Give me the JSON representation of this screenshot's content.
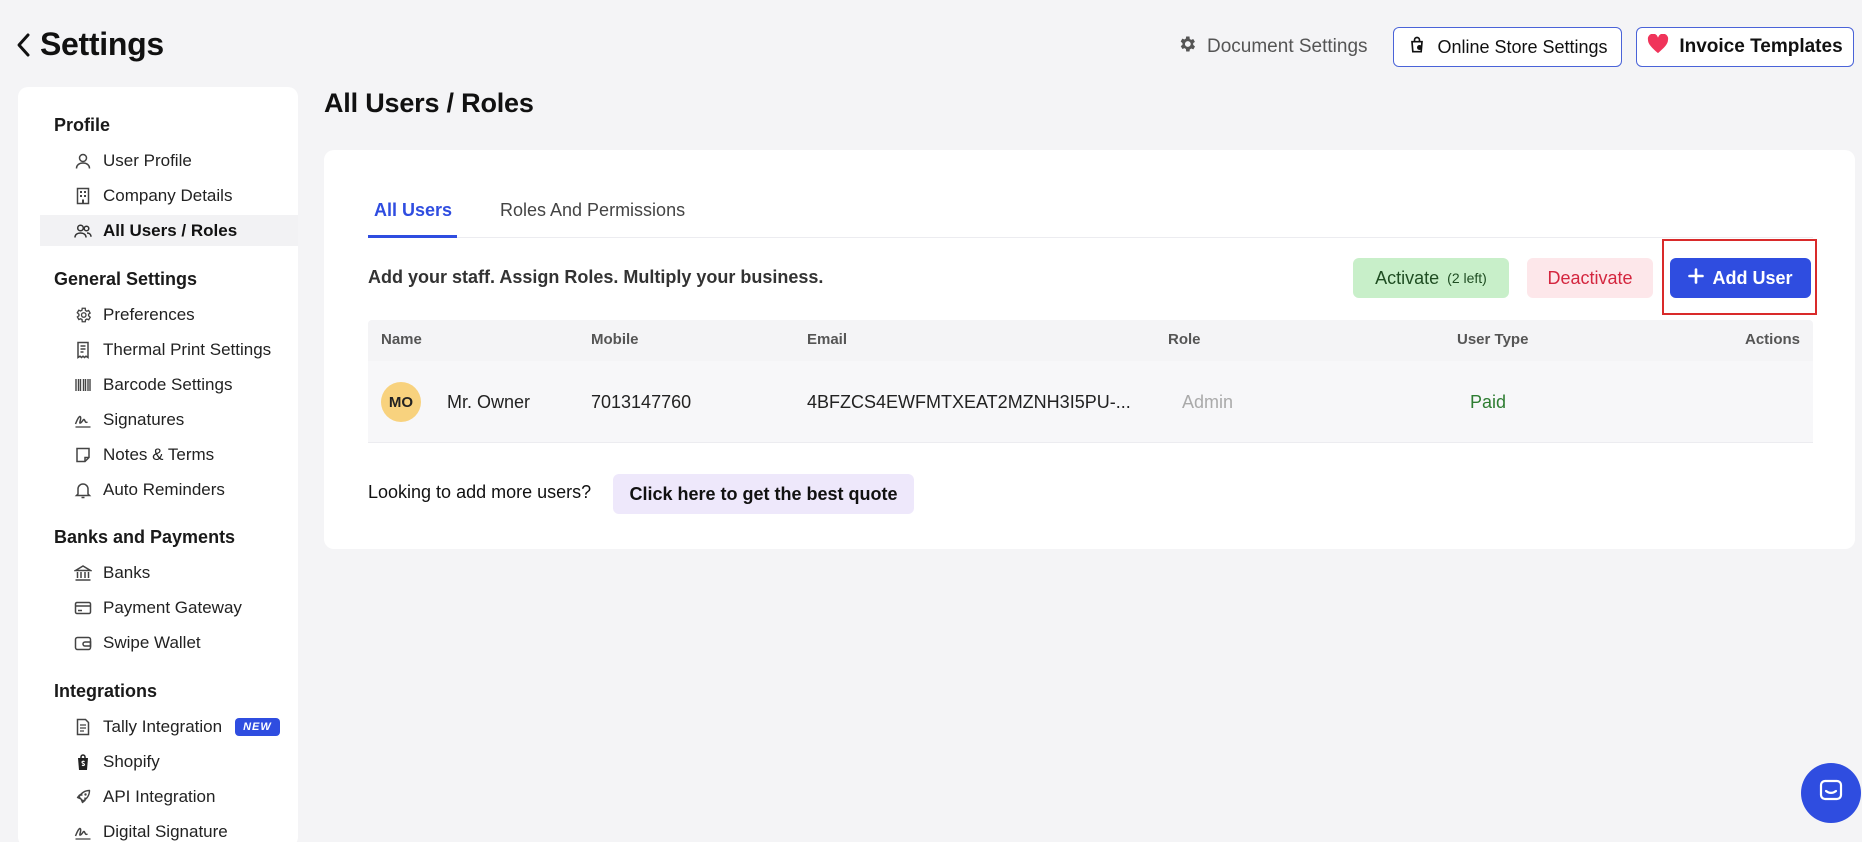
{
  "header": {
    "title": "Settings",
    "document_settings": "Document Settings",
    "online_store_settings": "Online Store Settings",
    "invoice_templates": "Invoice Templates"
  },
  "sidebar": {
    "sections": [
      {
        "title": "Profile",
        "items": [
          {
            "label": "User Profile",
            "icon": "user-icon"
          },
          {
            "label": "Company Details",
            "icon": "building-icon"
          },
          {
            "label": "All Users / Roles",
            "icon": "users-icon",
            "active": true
          }
        ]
      },
      {
        "title": "General Settings",
        "items": [
          {
            "label": "Preferences",
            "icon": "gear-icon"
          },
          {
            "label": "Thermal Print Settings",
            "icon": "receipt-icon"
          },
          {
            "label": "Barcode Settings",
            "icon": "barcode-icon"
          },
          {
            "label": "Signatures",
            "icon": "signature-icon"
          },
          {
            "label": "Notes & Terms",
            "icon": "note-icon"
          },
          {
            "label": "Auto Reminders",
            "icon": "bell-icon"
          }
        ]
      },
      {
        "title": "Banks and Payments",
        "items": [
          {
            "label": "Banks",
            "icon": "bank-icon"
          },
          {
            "label": "Payment Gateway",
            "icon": "credit-card-icon"
          },
          {
            "label": "Swipe Wallet",
            "icon": "wallet-icon"
          }
        ]
      },
      {
        "title": "Integrations",
        "items": [
          {
            "label": "Tally Integration",
            "icon": "document-icon",
            "badge": "NEW"
          },
          {
            "label": "Shopify",
            "icon": "shopify-icon"
          },
          {
            "label": "API Integration",
            "icon": "rocket-icon"
          },
          {
            "label": "Digital Signature",
            "icon": "digital-signature-icon"
          }
        ]
      }
    ]
  },
  "main": {
    "title": "All Users / Roles",
    "tabs": [
      {
        "label": "All Users",
        "active": true
      },
      {
        "label": "Roles And Permissions",
        "active": false
      }
    ],
    "tagline": "Add your staff. Assign Roles. Multiply your business.",
    "activate_label": "Activate",
    "activate_count": "(2 left)",
    "deactivate_label": "Deactivate",
    "add_user_label": "Add User",
    "table": {
      "columns": [
        "Name",
        "Mobile",
        "Email",
        "Role",
        "User Type",
        "Actions"
      ],
      "rows": [
        {
          "initials": "MO",
          "name": "Mr. Owner",
          "mobile": "7013147760",
          "email": "4BFZCS4EWFMTXEAT2MZNH3I5PU-...",
          "role": "Admin",
          "user_type": "Paid"
        }
      ]
    },
    "quote_question": "Looking to add more users?",
    "quote_button": "Click here to get the best quote"
  },
  "colors": {
    "accent": "#2f4de0",
    "activate_bg": "#c8efc9",
    "deactivate_text": "#d4263f",
    "avatar_bg": "#f8d27e",
    "paid_text": "#2e7d32",
    "highlight_border": "#d92a2a"
  }
}
